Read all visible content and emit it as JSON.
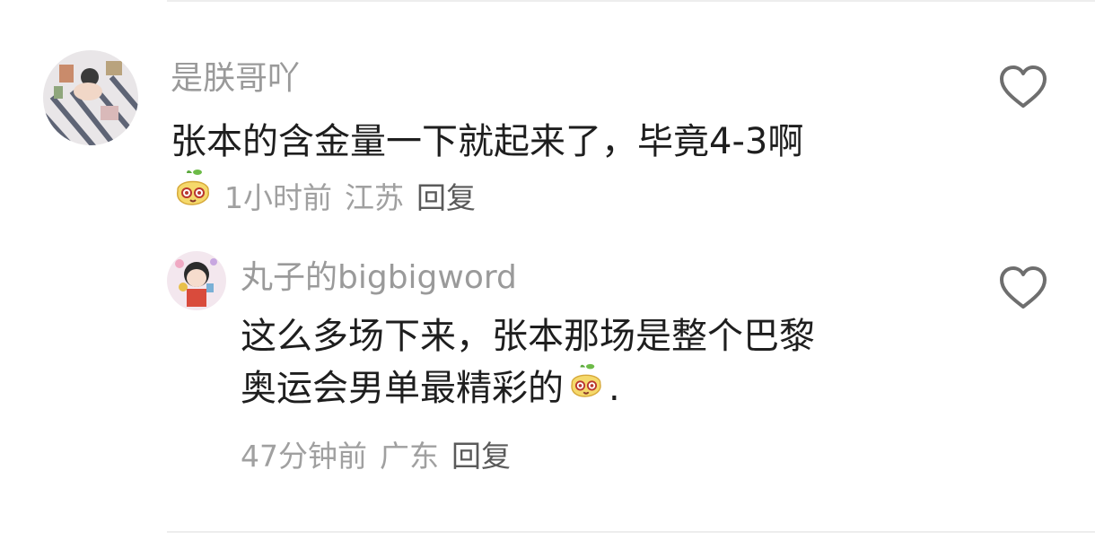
{
  "comments": [
    {
      "author": "是朕哥吖",
      "text": "张本的含金量一下就起来了，毕竟4-3啊",
      "meta": {
        "time": "1小时前",
        "location": "江苏",
        "reply": "回复"
      }
    },
    {
      "author": "丸子的bigbigword",
      "text_line1": "这么多场下来，张本那场是整个巴黎",
      "text_line2": "奥运会男单最精彩的",
      "text_suffix": ".",
      "meta": {
        "time": "47分钟前",
        "location": "广东",
        "reply": "回复"
      }
    }
  ],
  "icons": {
    "like": "heart-outline-icon",
    "sticker": "mango-face-emoji-icon"
  },
  "colors": {
    "name": "#9a9a9a",
    "text": "#1e1e1e",
    "meta": "#a0a0a0",
    "reply": "#5a5a5a",
    "divider": "#ededed"
  }
}
